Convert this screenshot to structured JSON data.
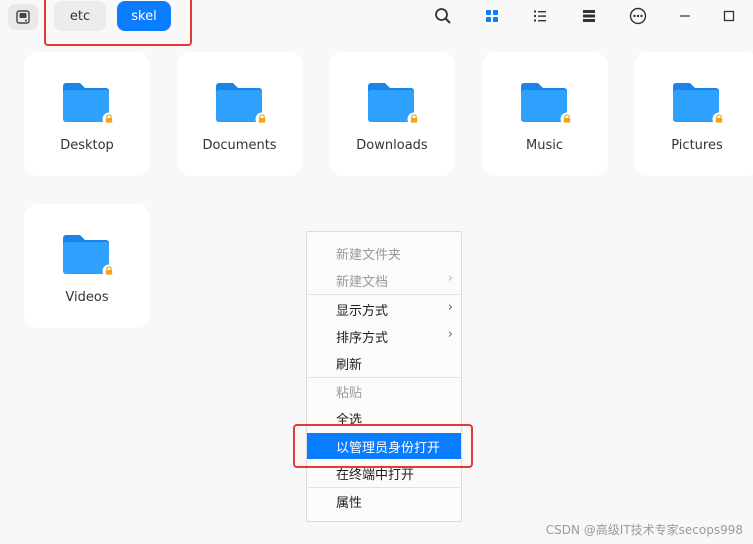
{
  "topbar": {
    "breadcrumbs": [
      {
        "label": "etc",
        "active": false
      },
      {
        "label": "skel",
        "active": true
      }
    ],
    "icons": [
      "disk-icon",
      "search-icon",
      "grid-view-icon",
      "list-view-icon",
      "tree-view-icon",
      "more-icon",
      "minimize-icon",
      "maximize-icon"
    ]
  },
  "folders": [
    {
      "name": "Desktop",
      "locked": true
    },
    {
      "name": "Documents",
      "locked": true
    },
    {
      "name": "Downloads",
      "locked": true
    },
    {
      "name": "Music",
      "locked": true
    },
    {
      "name": "Pictures",
      "locked": true
    },
    {
      "name": "Videos",
      "locked": true
    }
  ],
  "context_menu": {
    "items": [
      {
        "label": "新建文件夹",
        "disabled": true
      },
      {
        "label": "新建文档",
        "disabled": true,
        "submenu": true
      },
      {
        "label": "显示方式",
        "submenu": true
      },
      {
        "label": "排序方式",
        "submenu": true
      },
      {
        "label": "刷新"
      },
      {
        "label": "粘贴",
        "disabled": true
      },
      {
        "label": "全选"
      },
      {
        "label": "以管理员身份打开",
        "highlighted": true
      },
      {
        "label": "在终端中打开"
      },
      {
        "label": "属性"
      }
    ],
    "arrow": "›"
  },
  "colors": {
    "accent": "#0a7cff",
    "annotation": "#e53838",
    "folder": "#1e90ff"
  },
  "watermark": "CSDN @高级IT技术专家secops998"
}
